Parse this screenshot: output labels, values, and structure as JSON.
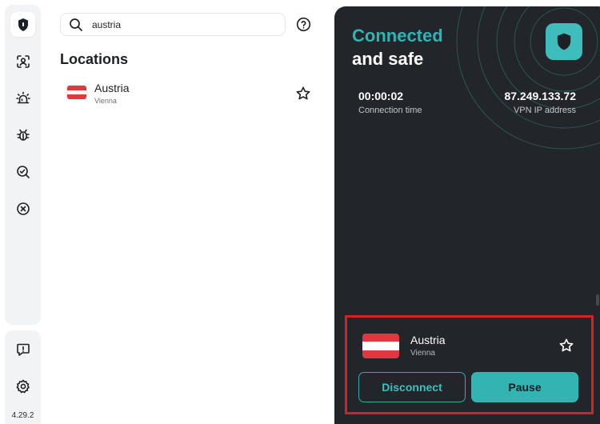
{
  "app": {
    "version": "4.29.2",
    "accent": "#2bb5b5",
    "danger": "#d62027"
  },
  "sidebar": {
    "items": [
      {
        "name": "sidebar-item-vpn",
        "icon": "shield-icon",
        "active": true
      },
      {
        "name": "sidebar-item-identity",
        "icon": "user-scan-icon",
        "active": false
      },
      {
        "name": "sidebar-item-alerts",
        "icon": "alarm-icon",
        "active": false
      },
      {
        "name": "sidebar-item-malware",
        "icon": "bug-icon",
        "active": false
      },
      {
        "name": "sidebar-item-scan",
        "icon": "search-scan-icon",
        "active": false
      },
      {
        "name": "sidebar-item-block",
        "icon": "block-icon",
        "active": false
      }
    ],
    "bottom": [
      {
        "name": "feedback-button",
        "icon": "feedback-icon"
      },
      {
        "name": "settings-button",
        "icon": "gear-icon"
      }
    ]
  },
  "search": {
    "value": "austria",
    "placeholder": "Search"
  },
  "locations": {
    "title": "Locations",
    "items": [
      {
        "country": "Austria",
        "city": "Vienna",
        "flag_colors": [
          "#e3373f",
          "#ffffff",
          "#e3373f"
        ]
      }
    ]
  },
  "status": {
    "line1": "Connected",
    "line2": "and safe",
    "connection_time": "00:00:02",
    "connection_time_label": "Connection time",
    "ip": "87.249.133.72",
    "ip_label": "VPN IP address"
  },
  "connection": {
    "country": "Austria",
    "city": "Vienna",
    "disconnect_label": "Disconnect",
    "pause_label": "Pause"
  }
}
